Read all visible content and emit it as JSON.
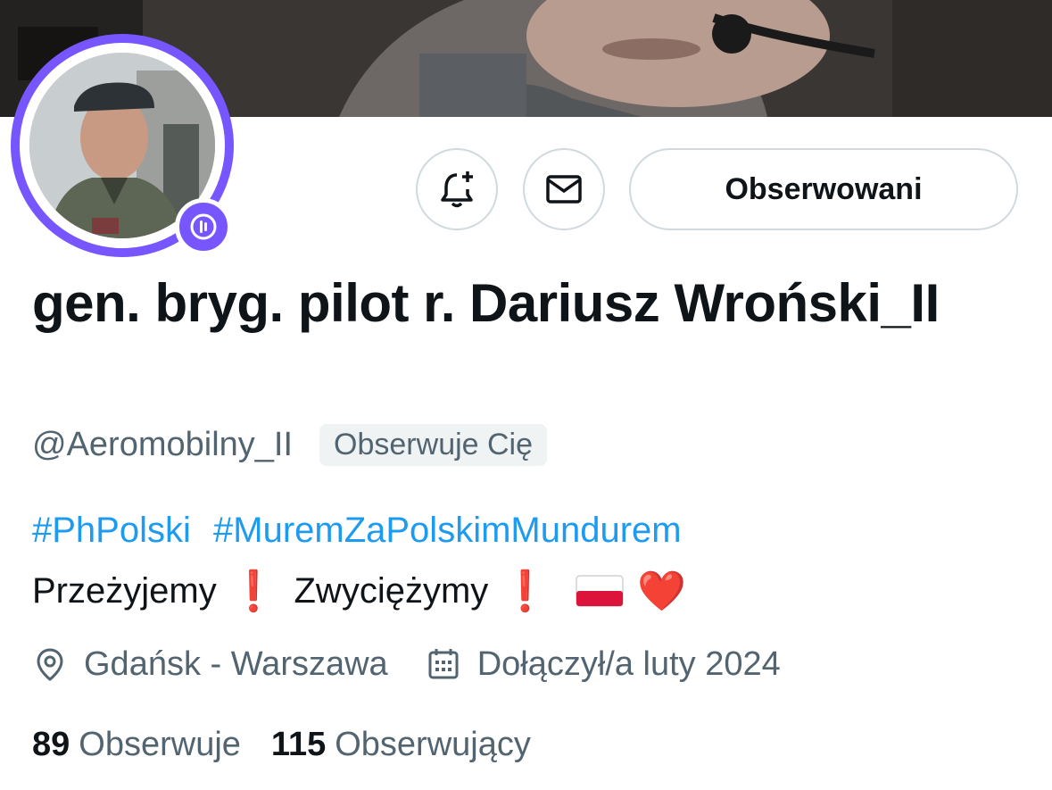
{
  "profile": {
    "display_name": "gen. bryg. pilot r. Dariusz Wroński_II",
    "handle": "@Aeromobilny_II",
    "follows_you_label": "Obserwuje Cię"
  },
  "actions": {
    "follow_state_label": "Obserwowani",
    "notify_icon": "bell-plus-icon",
    "message_icon": "mail-icon"
  },
  "bio": {
    "hashtags": [
      "#PhPolski",
      "#MuremZaPolskimMundurem"
    ],
    "line_word_1": "Przeżyjemy",
    "line_word_2": "Zwyciężymy",
    "exclamation": "❗",
    "heart": "❤️"
  },
  "meta": {
    "location": "Gdańsk - Warszawa",
    "joined": "Dołączył/a luty 2024"
  },
  "stats": {
    "following_count": "89",
    "following_label": "Obserwuje",
    "followers_count": "115",
    "followers_label": "Obserwujący"
  },
  "colors": {
    "spaces_ring": "#7856ff",
    "hashtag": "#1d9bf0",
    "secondary_text": "#536471",
    "border": "#cfd9de"
  }
}
